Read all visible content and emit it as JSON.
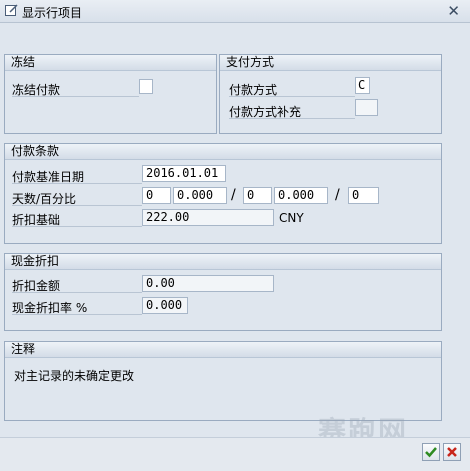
{
  "window": {
    "title": "显示行项目",
    "close_icon": "close-icon"
  },
  "freeze": {
    "header": "冻结",
    "payment_block_label": "冻结付款",
    "payment_block_checked": false
  },
  "payment_method": {
    "header": "支付方式",
    "method_label": "付款方式",
    "method_value": "C",
    "supplement_label": "付款方式补充",
    "supplement_value": ""
  },
  "terms": {
    "header": "付款条款",
    "baseline_label": "付款基准日期",
    "baseline_value": "2016.01.01",
    "days_label": "天数/百分比",
    "days1": "0",
    "pct1": "0.000",
    "days2": "0",
    "pct2": "0.000",
    "days3": "0",
    "separator": "/",
    "discount_base_label": "折扣基础",
    "discount_base_value": "222.00",
    "currency": "CNY"
  },
  "cash_discount": {
    "header": "现金折扣",
    "amount_label": "折扣金额",
    "amount_value": "0.00",
    "rate_label": "现金折扣率 %",
    "rate_value": "0.000"
  },
  "notes": {
    "header": "注释",
    "text": "对主记录的未确定更改"
  },
  "watermark": "赛跑网",
  "footer": {
    "ok_icon": "checkmark-icon",
    "cancel_icon": "cancel-icon"
  }
}
